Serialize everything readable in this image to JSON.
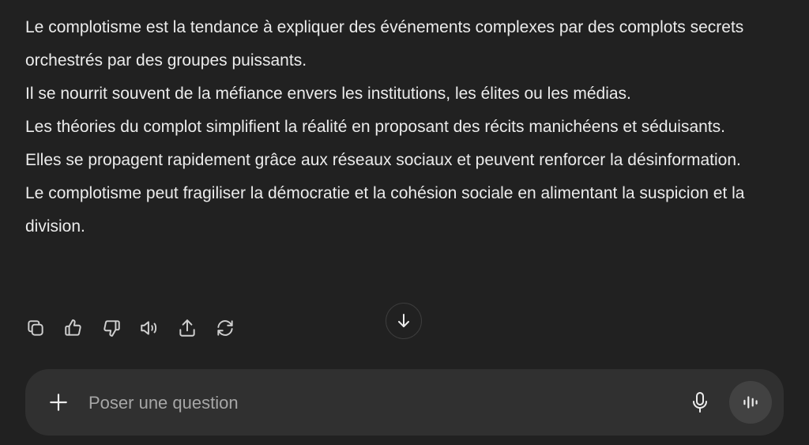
{
  "message": {
    "paragraphs": [
      "Le complotisme est la tendance à expliquer des événements complexes par des complots secrets orchestrés par des groupes puissants.",
      "Il se nourrit souvent de la méfiance envers les institutions, les élites ou les médias.",
      "Les théories du complot simplifient la réalité en proposant des récits manichéens et séduisants.",
      "Elles se propagent rapidement grâce aux réseaux sociaux et peuvent renforcer la désinformation.",
      "Le complotisme peut fragiliser la démocratie et la cohésion sociale en alimentant la suspicion et la division."
    ]
  },
  "actions": {
    "icons": [
      "copy-icon",
      "thumbs-up-icon",
      "thumbs-down-icon",
      "read-aloud-icon",
      "share-icon",
      "regenerate-icon"
    ]
  },
  "composer": {
    "placeholder": "Poser une question",
    "value": ""
  },
  "colors": {
    "background": "#212121",
    "composer": "#303030",
    "text": "#ececec",
    "placeholder": "#a6a6a6",
    "voice_button": "#424242"
  }
}
